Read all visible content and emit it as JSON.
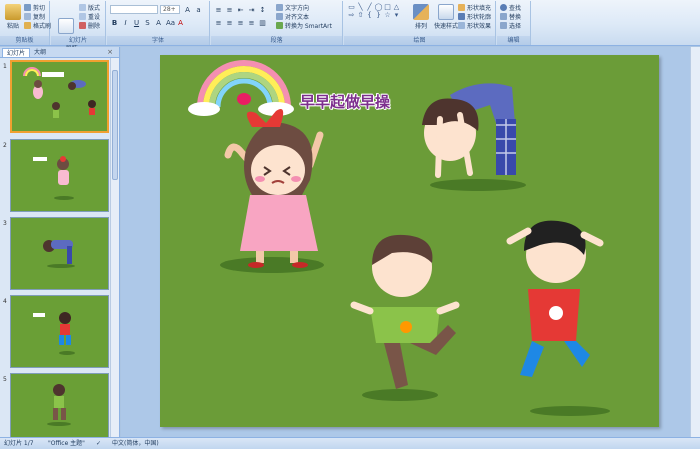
{
  "ribbon": {
    "groups": [
      {
        "label": "剪贴板",
        "big": "粘贴",
        "small": [
          "剪切",
          "复制",
          "格式刷"
        ]
      },
      {
        "label": "幻灯片",
        "big": "新建\n幻灯片",
        "small": [
          "版式",
          "重设",
          "删除"
        ]
      },
      {
        "label": "字体",
        "font_size": "28+"
      },
      {
        "label": "段落",
        "small": [
          "文字方向",
          "对齐文本",
          "转换为 SmartArt"
        ]
      },
      {
        "label": "绘图",
        "arrange": "排列",
        "quick_styles": "快速样式",
        "small": [
          "形状填充",
          "形状轮廓",
          "形状效果"
        ]
      },
      {
        "label": "编辑",
        "small": [
          "查找",
          "替换",
          "选择"
        ]
      }
    ]
  },
  "pane": {
    "tabs": [
      "幻灯片",
      "大纲"
    ],
    "close": "×",
    "slides": [
      "1",
      "2",
      "3",
      "4",
      "5"
    ]
  },
  "slide": {
    "title": "早早起做早操"
  },
  "status": {
    "slide_pos": "幻灯片 1/7",
    "theme": "\"Office 主题\"",
    "lang": "中文(简体，中国)"
  },
  "colors": {
    "slide_bg": "#6b9c38",
    "title": "#7d2f8e"
  }
}
